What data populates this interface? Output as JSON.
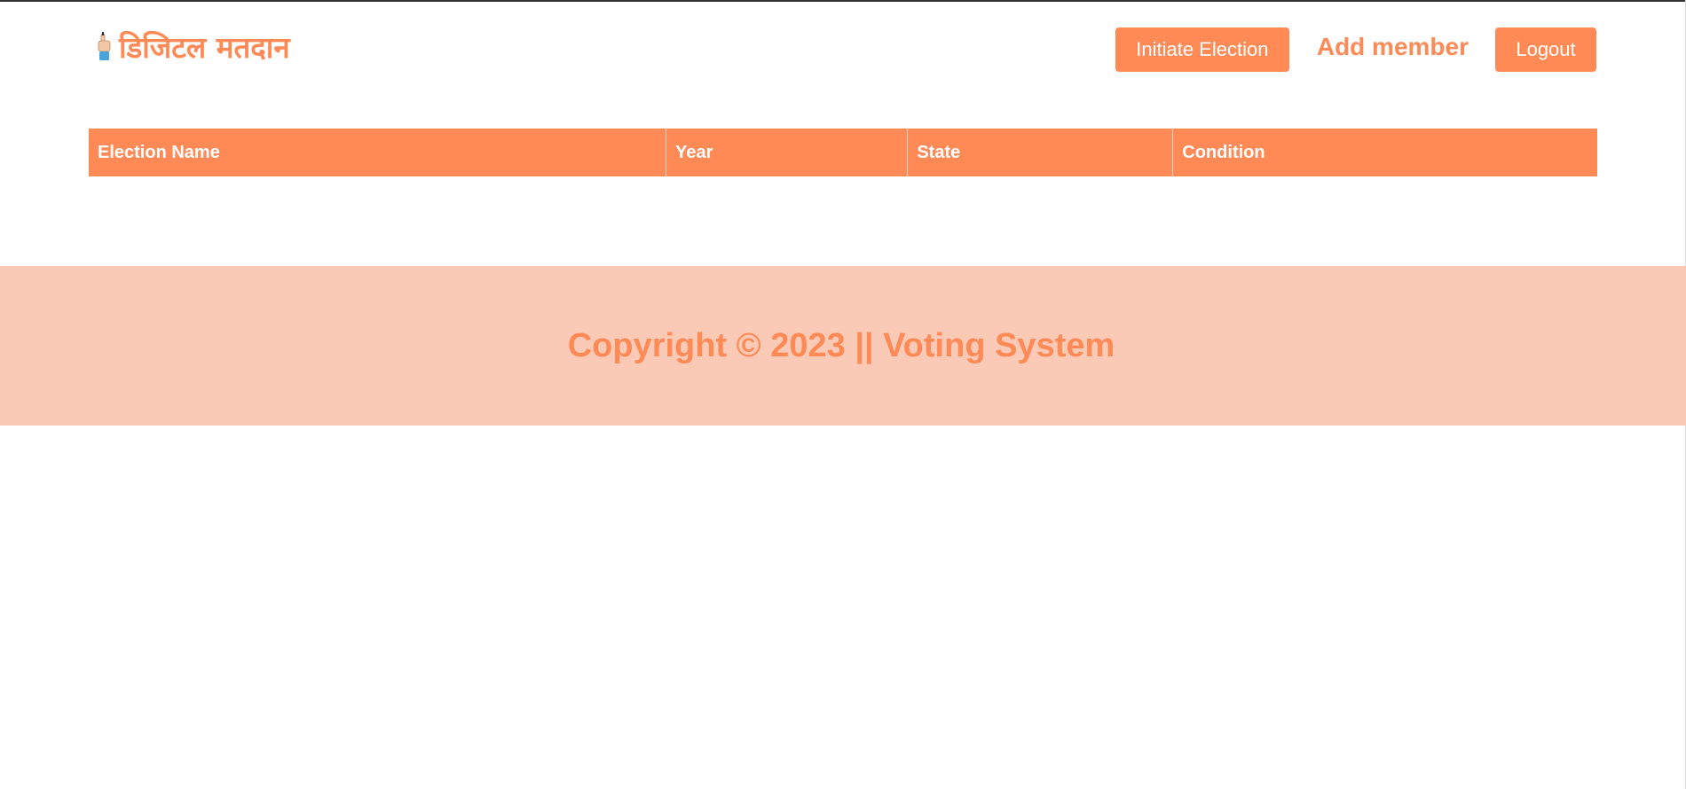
{
  "brand": {
    "title": "डिजिटल मतदान",
    "icon": "voting-finger-icon"
  },
  "nav": {
    "initiate_label": "Initiate Election",
    "add_member_label": "Add member",
    "logout_label": "Logout"
  },
  "table": {
    "columns": [
      "Election Name",
      "Year",
      "State",
      "Condition"
    ],
    "rows": []
  },
  "footer": {
    "copyright": "Copyright © 2023 || Voting System"
  },
  "colors": {
    "accent": "#ff8a56",
    "footer_bg": "#fbcab6"
  }
}
